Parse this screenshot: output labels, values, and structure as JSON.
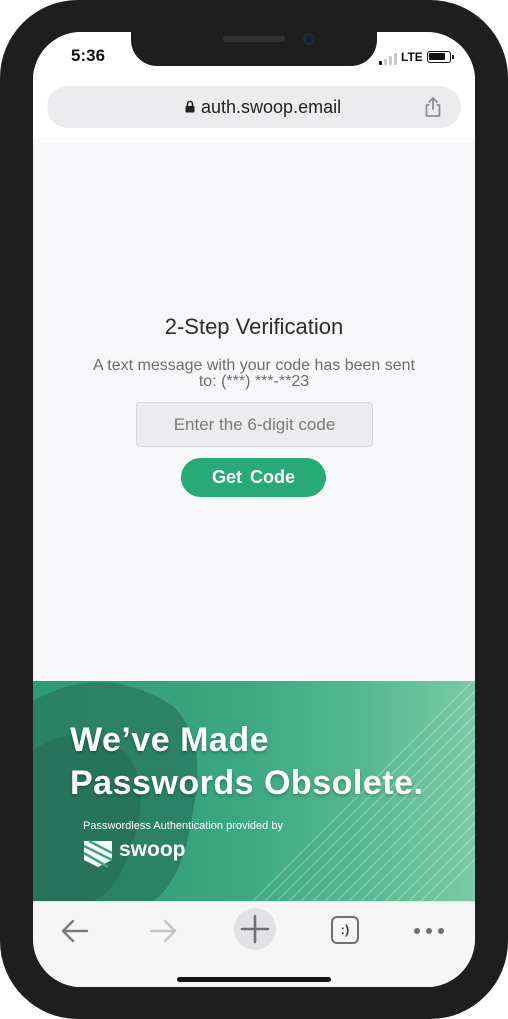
{
  "status_bar": {
    "time": "5:36",
    "network": "LTE"
  },
  "browser": {
    "url": "auth.swoop.email",
    "icons": {
      "lock": "lock-icon",
      "share": "share-icon"
    }
  },
  "verification": {
    "title": "2-Step Verification",
    "description": "A text message with your code has been sent to: (***) ***-**23",
    "code_input": {
      "placeholder": "Enter the 6-digit code",
      "value": ""
    },
    "button_label": "Get  Code"
  },
  "banner": {
    "headline_line1": "We’ve Made",
    "headline_line2": "Passwords Obsolete.",
    "provided_by": "Passwordless Authentication provided by",
    "brand": "swoop"
  },
  "toolbar": {
    "tabs_label": ":)",
    "icons": [
      "back-arrow-icon",
      "forward-arrow-icon",
      "new-tab-plus-icon",
      "tabs-icon",
      "more-icon"
    ]
  },
  "colors": {
    "accent": "#27a978",
    "banner_dark": "#2f9a74",
    "phone_frame": "#1e1e1e",
    "page_background": "#f8f8fb"
  }
}
